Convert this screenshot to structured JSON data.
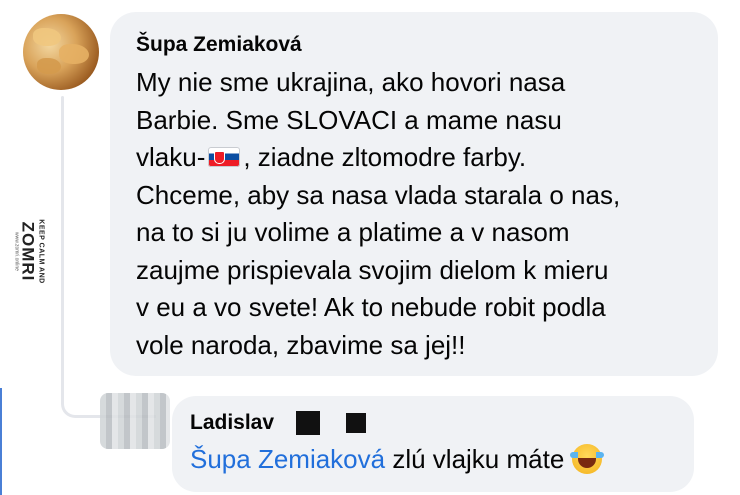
{
  "comment": {
    "author": "Šupa Zemiaková",
    "lines": [
      "My nie sme ukrajina, ako hovori nasa",
      "Barbie. Sme SLOVACI a mame nasu",
      ", ziadne zltomodre farby.",
      "Chceme, aby sa nasa vlada starala o nas,",
      "na to si ju volime a platime a v nasom",
      "zaujme prispievala svojim dielom k mieru",
      "v eu a vo svete! Ak to nebude robit podla",
      "vole naroda, zbavime sa jej!!"
    ],
    "line3_prefix": "vlaku-",
    "flag_icon": "slovakia-flag-icon"
  },
  "reply": {
    "author": "Ladislav",
    "mention": "Šupa Zemiaková",
    "text": " zlú vlajku máte",
    "emoji": "tears-of-joy-emoji-icon",
    "mention_color": "#216fdb"
  },
  "watermark": {
    "top": "KEEP CALM AND",
    "main": "ZOMRI",
    "url": "www.zomri.online"
  },
  "colors": {
    "bubble": "#f0f2f5",
    "text": "#050505",
    "thread_line": "#e4e6eb"
  }
}
